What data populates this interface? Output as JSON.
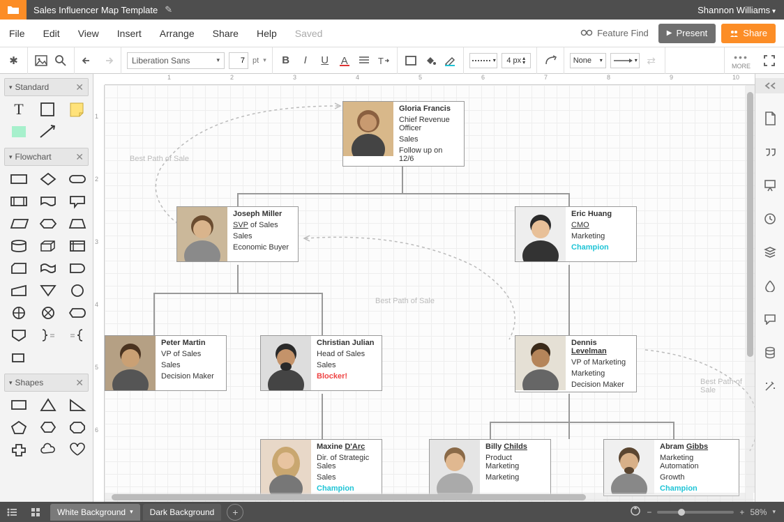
{
  "titlebar": {
    "title": "Sales Influencer Map Template",
    "user": "Shannon Williams"
  },
  "menu": {
    "file": "File",
    "edit": "Edit",
    "view": "View",
    "insert": "Insert",
    "arrange": "Arrange",
    "share": "Share",
    "help": "Help",
    "saved": "Saved",
    "feature_find": "Feature Find",
    "present": "Present",
    "share_btn": "Share"
  },
  "toolbar": {
    "font": "Liberation Sans",
    "size": "7",
    "pt": "pt",
    "line_width": "4 px",
    "arrow_start": "None",
    "more": "MORE"
  },
  "panels": {
    "standard": "Standard",
    "flowchart": "Flowchart",
    "shapes": "Shapes"
  },
  "labels": {
    "best_path_1": "Best Path of Sale",
    "best_path_2": "Best Path of Sale",
    "best_path_3": "Best Path of Sale"
  },
  "ruler_h": {
    "t1": "1",
    "t2": "2",
    "t3": "3",
    "t4": "4",
    "t5": "5",
    "t6": "6",
    "t7": "7",
    "t8": "8",
    "t9": "9",
    "t10": "10"
  },
  "ruler_v": {
    "t1": "1",
    "t2": "2",
    "t3": "3",
    "t4": "4",
    "t5": "5",
    "t6": "6"
  },
  "nodes": {
    "gloria": {
      "name": "Gloria Francis",
      "role": "Chief Revenue Officer",
      "dept": "Sales",
      "note": "Follow up on 12/6"
    },
    "joseph": {
      "name": "Joseph Miller",
      "role_prefix": "SVP",
      "role_rest": " of Sales",
      "dept": "Sales",
      "note": "Economic Buyer"
    },
    "eric": {
      "name": "Eric Huang",
      "role": "CMO",
      "dept": "Marketing",
      "note": "Champion"
    },
    "peter": {
      "name": "Peter Martin",
      "role": "VP of Sales",
      "dept": "Sales",
      "note": "Decision Maker"
    },
    "christian": {
      "name": "Christian Julian",
      "role": "Head of Sales",
      "dept": "Sales",
      "note": "Blocker!"
    },
    "dennis": {
      "name": "Dennis ",
      "name_u": "Levelman",
      "role": "VP of Marketing",
      "dept": "Marketing",
      "note": "Decision Maker"
    },
    "maxine": {
      "name": "Maxine ",
      "name_u": "D'Arc",
      "role": "Dir. of Strategic Sales",
      "dept": "Sales",
      "note": "Champion"
    },
    "billy": {
      "name": "Billy ",
      "name_u": "Childs",
      "role": "Product Marketing",
      "dept": "Marketing"
    },
    "abram": {
      "name": "Abram ",
      "name_u": "Gibbs",
      "role": "Marketing Automation",
      "dept": "Growth",
      "note": "Champion"
    }
  },
  "pages": {
    "p1": "White Background",
    "p2": "Dark Background"
  },
  "zoom": {
    "value": "58%"
  }
}
